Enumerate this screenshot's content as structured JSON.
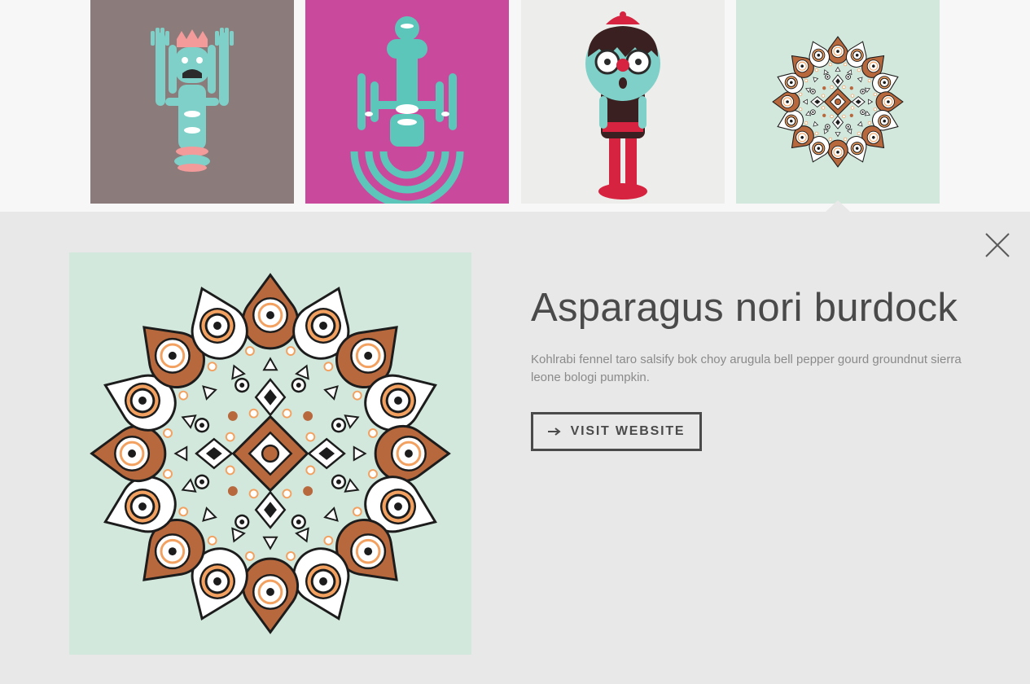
{
  "gallery": {
    "items": [
      {
        "name": "Crowned many-armed figure",
        "bg": "#8c7b7b"
      },
      {
        "name": "Totem figure with rings",
        "bg": "#c94a9c"
      },
      {
        "name": "Boy with red cap",
        "bg": "#ededeb"
      },
      {
        "name": "Mandala pattern",
        "bg": "#d3e8dd",
        "selected": true
      }
    ]
  },
  "detail": {
    "title": "Asparagus nori burdock",
    "description": "Kohlrabi fennel taro salsify bok choy arugula bell pepper gourd groundnut sierra leone bologi pumpkin.",
    "visit_label": "Visit Website",
    "preview_bg": "#d3e8dd"
  },
  "icons": {
    "close": "close-icon",
    "arrow": "arrow-right-icon"
  },
  "colors": {
    "teal": "#7fd0c8",
    "pink": "#f39a9a",
    "brown": "#b7683c",
    "orange": "#f3a160",
    "text_dark": "#4a4a4a",
    "text_muted": "#8a8a8a",
    "panel_bg": "#e8e8e8"
  }
}
